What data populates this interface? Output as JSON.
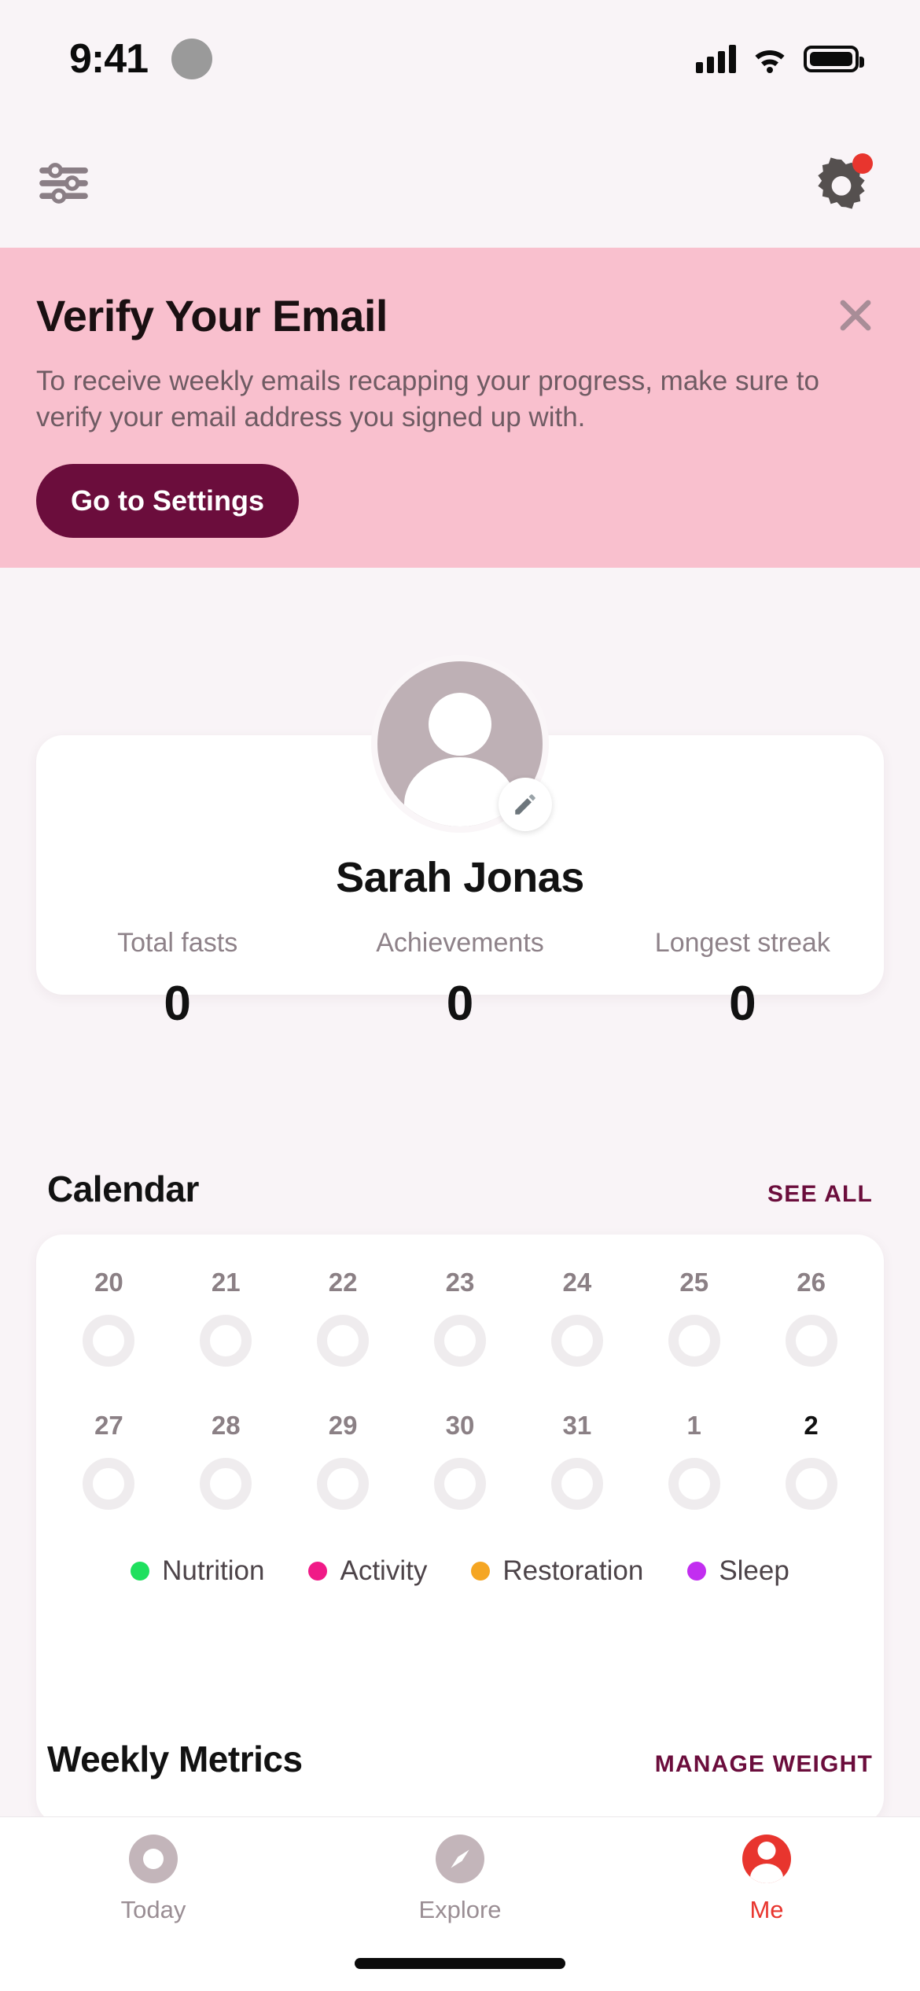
{
  "status_bar": {
    "time": "9:41",
    "icons": [
      "cellular-signal-icon",
      "wifi-icon",
      "battery-icon"
    ]
  },
  "app_bar": {
    "left_icon": "sliders-filter-icon",
    "right_icon": "gear-settings-icon",
    "notification_badge": true
  },
  "banner": {
    "title": "Verify Your Email",
    "body": "To receive weekly emails recapping your progress, make sure to verify your email address you signed up with.",
    "cta_label": "Go to Settings",
    "close_icon": "close-x-icon",
    "background": "#f9c0ce",
    "cta_background": "#6b0d3c"
  },
  "profile": {
    "name": "Sarah Jonas",
    "avatar_icon": "person-avatar-icon",
    "edit_icon": "pencil-edit-icon",
    "stats": [
      {
        "label": "Total fasts",
        "value": "0"
      },
      {
        "label": "Achievements",
        "value": "0"
      },
      {
        "label": "Longest streak",
        "value": "0"
      }
    ]
  },
  "calendar": {
    "title": "Calendar",
    "action_label": "SEE ALL",
    "weeks": [
      [
        {
          "day": "20",
          "today": false
        },
        {
          "day": "21",
          "today": false
        },
        {
          "day": "22",
          "today": false
        },
        {
          "day": "23",
          "today": false
        },
        {
          "day": "24",
          "today": false
        },
        {
          "day": "25",
          "today": false
        },
        {
          "day": "26",
          "today": false
        }
      ],
      [
        {
          "day": "27",
          "today": false
        },
        {
          "day": "28",
          "today": false
        },
        {
          "day": "29",
          "today": false
        },
        {
          "day": "30",
          "today": false
        },
        {
          "day": "31",
          "today": false
        },
        {
          "day": "1",
          "today": false
        },
        {
          "day": "2",
          "today": true
        }
      ]
    ],
    "legend": [
      {
        "label": "Nutrition",
        "color": "#1fe05e"
      },
      {
        "label": "Activity",
        "color": "#f01a87"
      },
      {
        "label": "Restoration",
        "color": "#f5a623"
      },
      {
        "label": "Sleep",
        "color": "#c22ef0"
      }
    ]
  },
  "weekly_metrics": {
    "title": "Weekly Metrics",
    "action_label": "MANAGE WEIGHT"
  },
  "tab_bar": {
    "tabs": [
      {
        "label": "Today",
        "icon": "today-ring-icon",
        "active": false
      },
      {
        "label": "Explore",
        "icon": "compass-icon",
        "active": false
      },
      {
        "label": "Me",
        "icon": "person-icon",
        "active": true
      }
    ],
    "active_color": "#e8352e",
    "inactive_color": "#c3b5ba"
  }
}
